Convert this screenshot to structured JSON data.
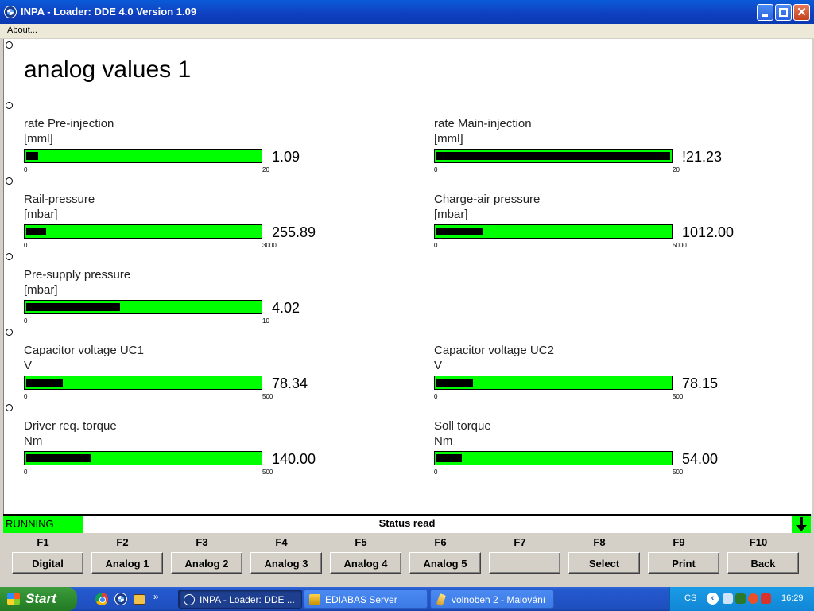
{
  "window": {
    "title": "INPA - Loader:  DDE 4.0 Version 1.09"
  },
  "menu": {
    "about": "About..."
  },
  "page": {
    "title": "analog values 1"
  },
  "gauges": [
    {
      "label": "rate Pre-injection",
      "unit": "[mml]",
      "value": "1.09",
      "min": "0",
      "max": "20",
      "fraction": 0.05
    },
    {
      "label": "rate Main-injection",
      "unit": "[mml]",
      "value": "!21.23",
      "min": "0",
      "max": "20",
      "fraction": 1.0
    },
    {
      "label": "Rail-pressure",
      "unit": "[mbar]",
      "value": "255.89",
      "min": "0",
      "max": "3000",
      "fraction": 0.085
    },
    {
      "label": "Charge-air pressure",
      "unit": "[mbar]",
      "value": "1012.00",
      "min": "0",
      "max": "5000",
      "fraction": 0.2
    },
    {
      "label": "Pre-supply pressure",
      "unit": "[mbar]",
      "value": "4.02",
      "min": "0",
      "max": "10",
      "fraction": 0.402
    },
    {
      "label": "Capacitor voltage UC1",
      "unit": "V",
      "value": "78.34",
      "min": "0",
      "max": "500",
      "fraction": 0.157
    },
    {
      "label": "Capacitor voltage UC2",
      "unit": "V",
      "value": "78.15",
      "min": "0",
      "max": "500",
      "fraction": 0.156
    },
    {
      "label": "Driver req. torque",
      "unit": "Nm",
      "value": "140.00",
      "min": "0",
      "max": "500",
      "fraction": 0.28
    },
    {
      "label": "Soll torque",
      "unit": "Nm",
      "value": "54.00",
      "min": "0",
      "max": "500",
      "fraction": 0.108
    }
  ],
  "status": {
    "state": "RUNNING",
    "text": "Status read"
  },
  "fkeys": [
    {
      "key": "F1",
      "label": "Digital"
    },
    {
      "key": "F2",
      "label": "Analog 1"
    },
    {
      "key": "F3",
      "label": "Analog 2"
    },
    {
      "key": "F4",
      "label": "Analog 3"
    },
    {
      "key": "F5",
      "label": "Analog 4"
    },
    {
      "key": "F6",
      "label": "Analog 5"
    },
    {
      "key": "F7",
      "label": ""
    },
    {
      "key": "F8",
      "label": "Select"
    },
    {
      "key": "F9",
      "label": "Print"
    },
    {
      "key": "F10",
      "label": "Back"
    }
  ],
  "taskbar": {
    "start": "Start",
    "tasks": [
      {
        "label": "INPA - Loader:  DDE ..."
      },
      {
        "label": "EDIABAS Server"
      },
      {
        "label": "volnobeh 2 - Malování"
      }
    ],
    "language": "CS",
    "clock": "16:29"
  },
  "colors": {
    "gauge_green": "#00ff00",
    "gauge_fill": "#000000",
    "title_blue": "#0a5bd8"
  },
  "icons": [
    "bmw-logo-icon",
    "minimize-icon",
    "maximize-icon",
    "close-icon",
    "down-arrow-icon",
    "windows-flag-icon",
    "chrome-icon",
    "show-desktop-icon",
    "ediabas-icon",
    "paint-icon"
  ]
}
